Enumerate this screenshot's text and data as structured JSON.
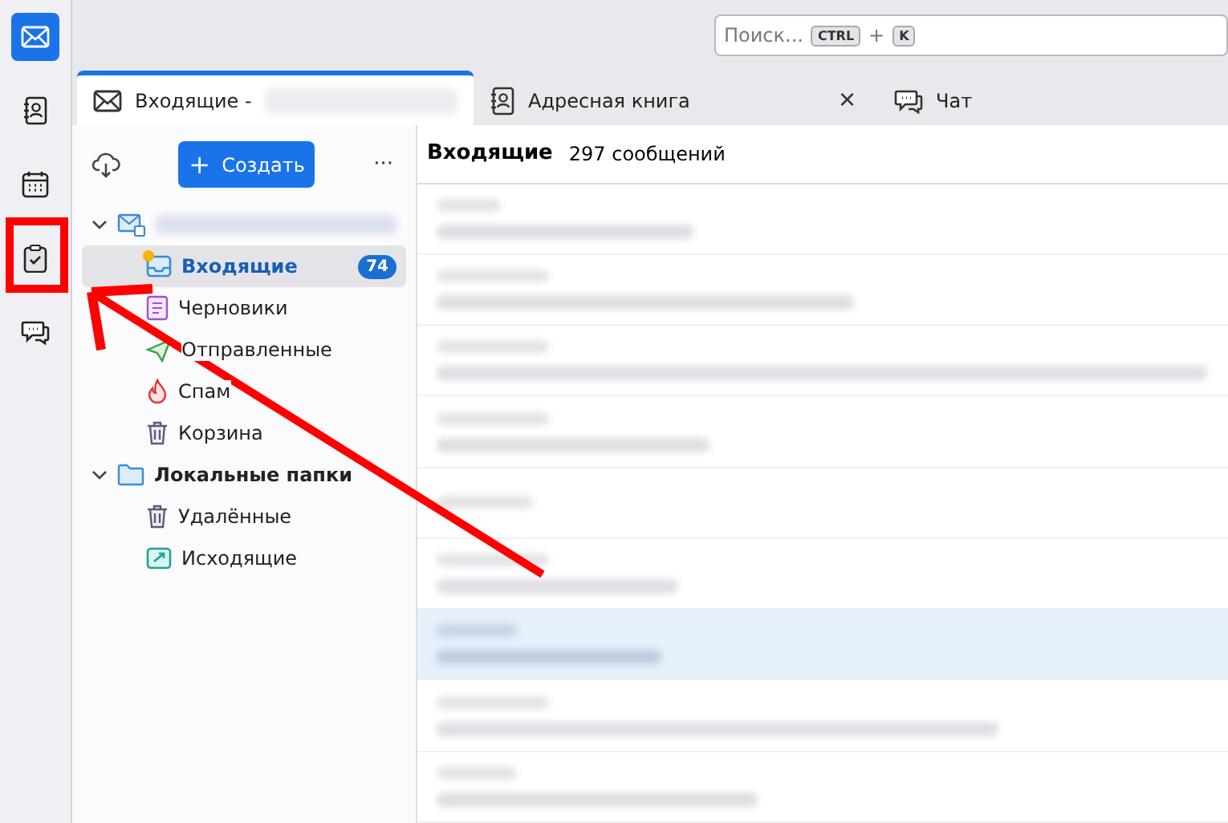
{
  "spaces_bar": [
    {
      "kind": "mail",
      "selected": true
    },
    {
      "kind": "address-book",
      "selected": false
    },
    {
      "kind": "calendar",
      "selected": false
    },
    {
      "kind": "tasks",
      "selected": false
    },
    {
      "kind": "chat",
      "selected": false
    }
  ],
  "search": {
    "placeholder": "Поиск...",
    "keys": [
      "CTRL",
      "K"
    ],
    "joiner": "+"
  },
  "tabs": [
    {
      "kind": "mail",
      "label": "Входящие -",
      "selected": true,
      "closable": false
    },
    {
      "kind": "address-book",
      "label": "Адресная книга",
      "selected": false,
      "closable": true
    },
    {
      "kind": "chat",
      "label": "Чат",
      "selected": false,
      "closable": false
    }
  ],
  "close_glyph": "×",
  "folder_pane": {
    "new_button": {
      "icon": "+",
      "label": "Создать"
    },
    "more": "···",
    "accounts": [
      {
        "kind": "mail-account",
        "expanded": true,
        "children": [
          {
            "kind": "inbox",
            "name": "Входящие",
            "selected": true,
            "new_mail": true,
            "unread": "74"
          },
          {
            "kind": "drafts",
            "name": "Черновики",
            "selected": false,
            "new_mail": false
          },
          {
            "kind": "sent",
            "name": "Отправленные",
            "selected": false,
            "new_mail": false
          },
          {
            "kind": "spam",
            "name": "Спам",
            "selected": false,
            "new_mail": false
          },
          {
            "kind": "trash",
            "name": "Корзина",
            "selected": false,
            "new_mail": false
          }
        ]
      },
      {
        "kind": "local",
        "name": "Локальные папки",
        "expanded": true,
        "children": [
          {
            "kind": "trash",
            "name": "Удалённые",
            "selected": false,
            "new_mail": false
          },
          {
            "kind": "outbox",
            "name": "Исходящие",
            "selected": false,
            "new_mail": false
          }
        ]
      }
    ]
  },
  "message_list": {
    "title": "Входящие",
    "count": "297 сообщений",
    "rows": [
      {
        "selected": false
      },
      {
        "selected": false
      },
      {
        "selected": false
      },
      {
        "selected": false
      },
      {
        "selected": false
      },
      {
        "selected": false
      },
      {
        "selected": true
      },
      {
        "selected": false
      },
      {
        "selected": false
      }
    ]
  }
}
